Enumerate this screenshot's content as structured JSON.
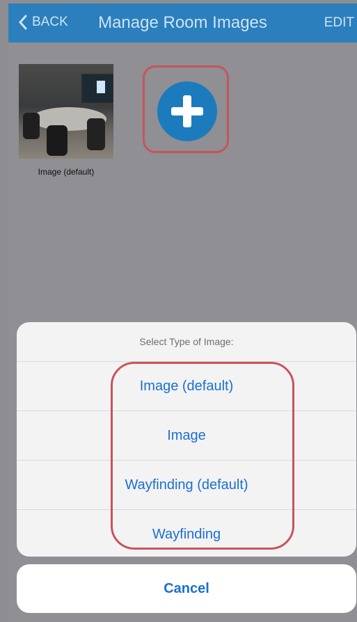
{
  "nav": {
    "back_label": "BACK",
    "title": "Manage Room Images",
    "edit_label": "EDIT"
  },
  "images": [
    {
      "label": "Image (default)"
    }
  ],
  "action_sheet": {
    "title": "Select Type of Image:",
    "options": [
      {
        "label": "Image (default)"
      },
      {
        "label": "Image"
      },
      {
        "label": "Wayfinding (default)"
      },
      {
        "label": "Wayfinding"
      }
    ],
    "cancel_label": "Cancel"
  },
  "colors": {
    "nav_bar": "#2b7fbd",
    "accent": "#1a6fd1",
    "highlight": "#c8545a"
  }
}
